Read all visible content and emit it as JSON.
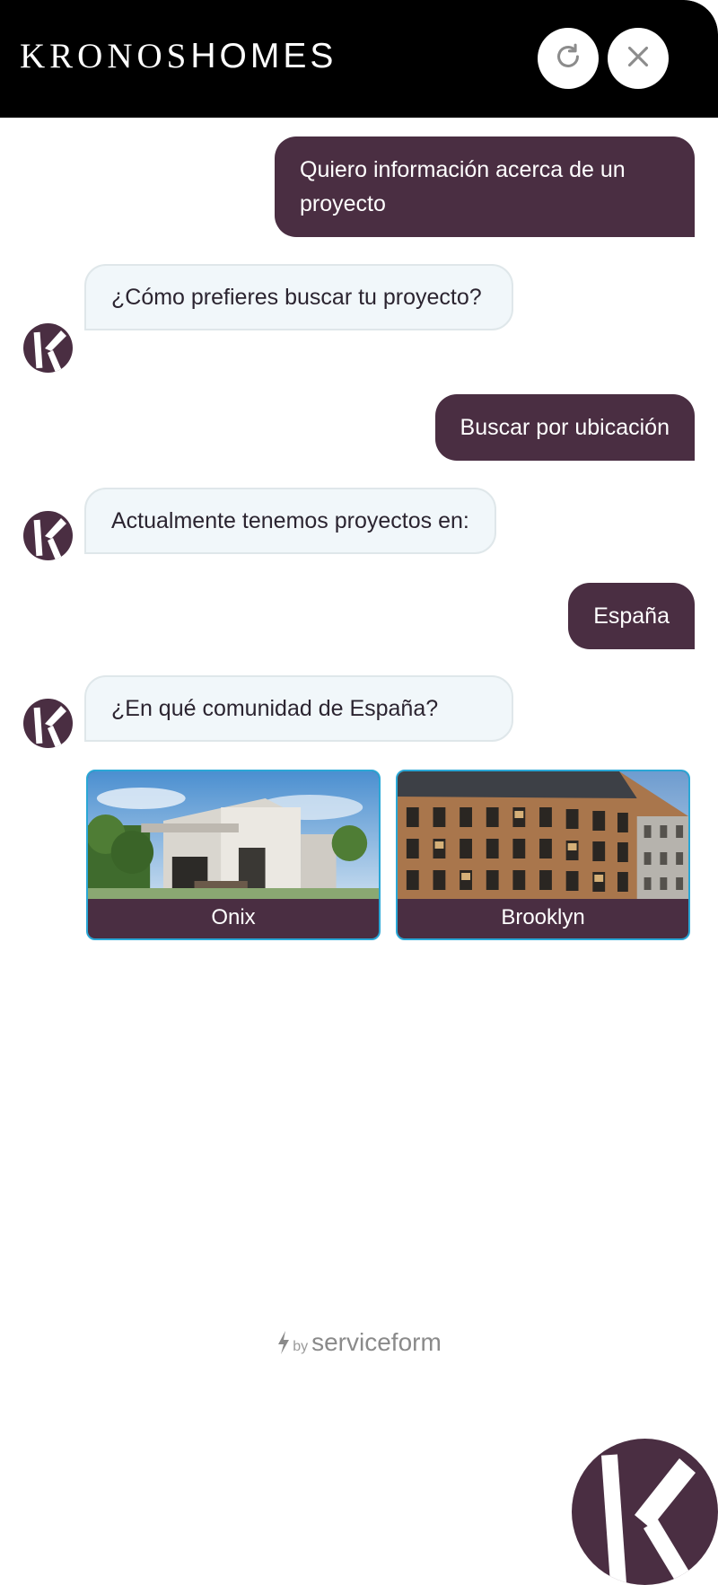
{
  "header": {
    "logo_bold": "KRONOS",
    "logo_light": "HOMES",
    "refresh_icon": "refresh-icon",
    "close_icon": "close-icon"
  },
  "messages": [
    {
      "from": "user",
      "text": "Quiero información acerca de un proyecto"
    },
    {
      "from": "bot",
      "text": "¿Cómo prefieres buscar tu proyecto?"
    },
    {
      "from": "user",
      "text": "Buscar por ubicación"
    },
    {
      "from": "bot",
      "text": "Actualmente tenemos proyectos en:"
    },
    {
      "from": "user",
      "text": "España"
    },
    {
      "from": "bot",
      "text": "¿En qué comunidad de España?"
    }
  ],
  "options": [
    {
      "label": "Onix"
    },
    {
      "label": "Brooklyn"
    }
  ],
  "footer": {
    "by": "by",
    "brand": "servicefᴏrm"
  },
  "colors": {
    "brand": "#4a2e42",
    "header": "#000000",
    "bot_bubble": "#f1f7fa",
    "card_border": "#2aa7d6"
  }
}
